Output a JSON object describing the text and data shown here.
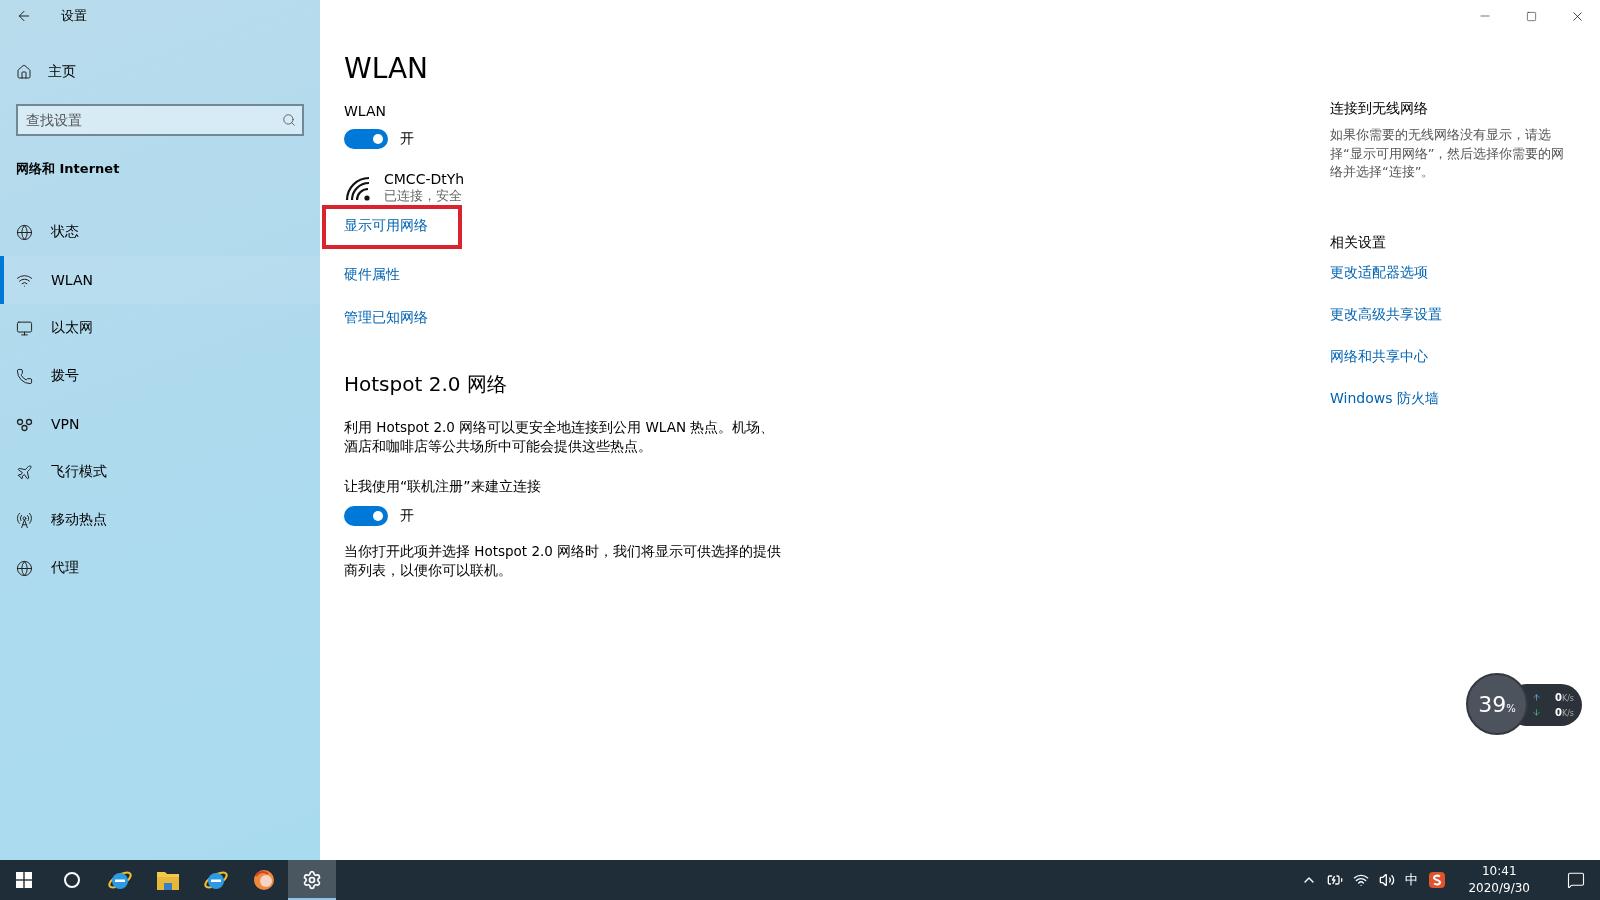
{
  "window": {
    "title": "设置"
  },
  "sidebar": {
    "home": "主页",
    "search": {
      "placeholder": "查找设置"
    },
    "section": "网络和 Internet",
    "items": [
      {
        "kind": "status",
        "label": "状态",
        "selected": false
      },
      {
        "kind": "wlan",
        "label": "WLAN",
        "selected": true
      },
      {
        "kind": "ethernet",
        "label": "以太网",
        "selected": false
      },
      {
        "kind": "dialup",
        "label": "拨号",
        "selected": false
      },
      {
        "kind": "vpn",
        "label": "VPN",
        "selected": false
      },
      {
        "kind": "airplane",
        "label": "飞行模式",
        "selected": false
      },
      {
        "kind": "hotspot",
        "label": "移动热点",
        "selected": false
      },
      {
        "kind": "proxy",
        "label": "代理",
        "selected": false
      }
    ]
  },
  "main": {
    "title": "WLAN",
    "wlan_toggle": {
      "label": "WLAN",
      "on": true,
      "state_text": "开"
    },
    "network": {
      "name": "CMCC-DtYh",
      "status": "已连接，安全"
    },
    "links": [
      {
        "label": "显示可用网络",
        "highlighted": true
      },
      {
        "label": "硬件属性",
        "highlighted": false
      },
      {
        "label": "管理已知网络",
        "highlighted": false
      }
    ],
    "hotspot": {
      "heading": "Hotspot 2.0 网络",
      "description": "利用 Hotspot 2.0 网络可以更安全地连接到公用 WLAN 热点。机场、酒店和咖啡店等公共场所中可能会提供这些热点。",
      "toggle": {
        "label": "让我使用“联机注册”来建立连接",
        "on": true,
        "state_text": "开"
      },
      "note": "当你打开此项并选择 Hotspot 2.0 网络时，我们将显示可供选择的提供商列表，以便你可以联机。"
    }
  },
  "aside": {
    "connect": {
      "heading": "连接到无线网络",
      "text": "如果你需要的无线网络没有显示，请选择“显示可用网络”，然后选择你需要的网络并选择“连接”。"
    },
    "related": {
      "heading": "相关设置",
      "links": [
        "更改适配器选项",
        "更改高级共享设置",
        "网络和共享中心",
        "Windows 防火墙"
      ]
    }
  },
  "net_meter": {
    "percent": "39",
    "percent_unit": "%",
    "upload": {
      "value": "0",
      "unit": "K/s"
    },
    "download": {
      "value": "0",
      "unit": "K/s"
    }
  },
  "taskbar": {
    "apps": [
      {
        "kind": "ie",
        "selected": false
      },
      {
        "kind": "explorer",
        "selected": false
      },
      {
        "kind": "ie",
        "selected": false
      },
      {
        "kind": "browser",
        "selected": false
      },
      {
        "kind": "settings",
        "selected": true
      }
    ],
    "ime": "中",
    "time": "10:41",
    "date": "2020/9/30"
  }
}
